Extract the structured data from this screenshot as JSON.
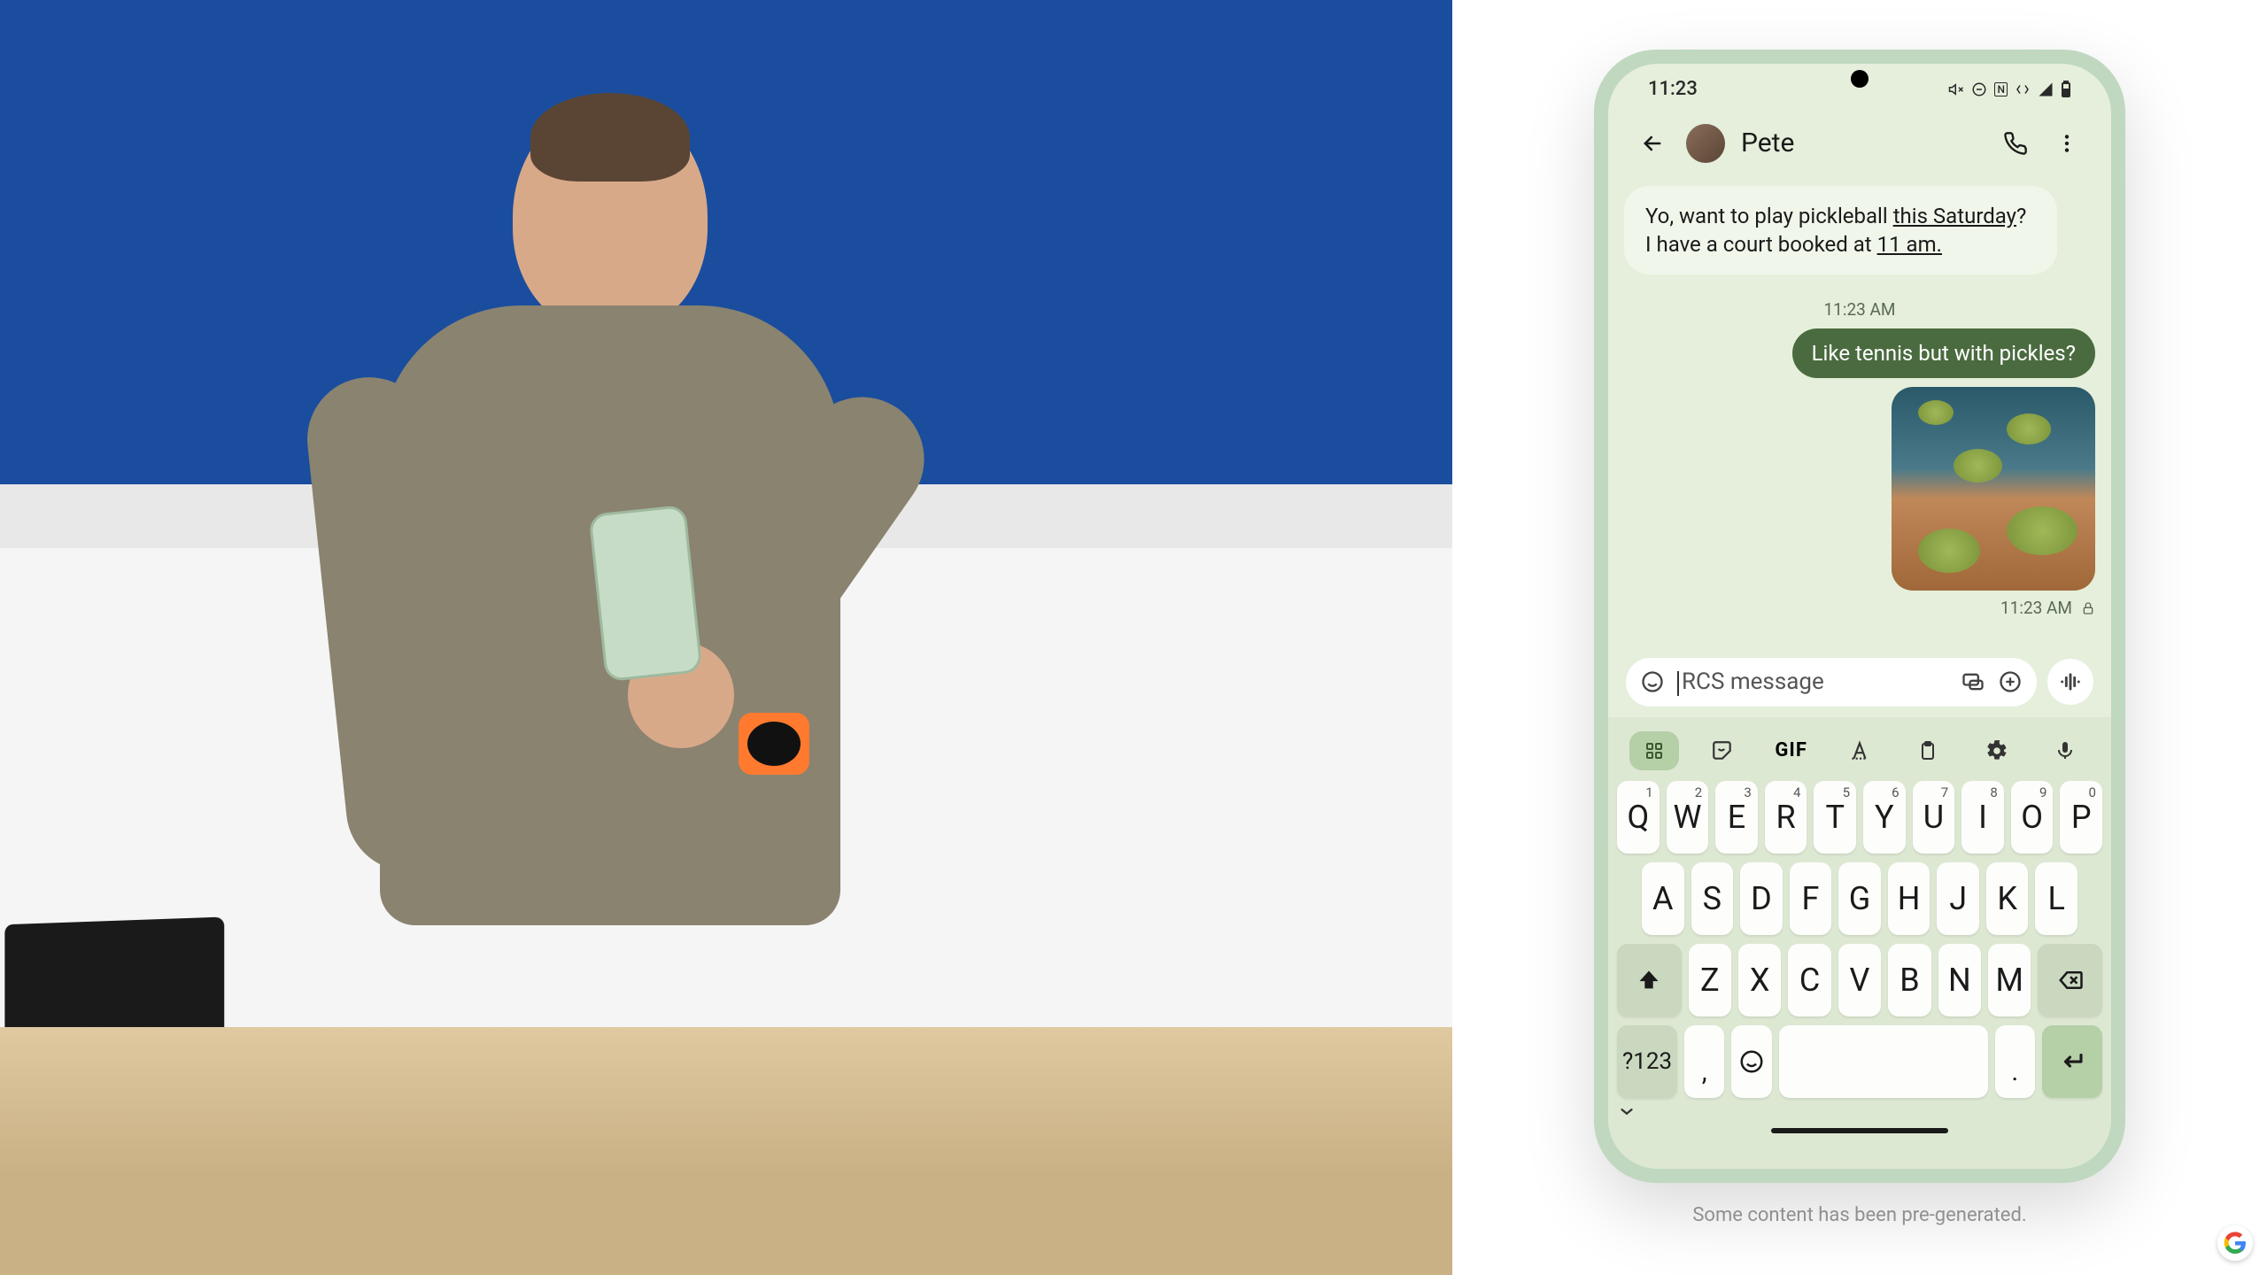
{
  "status_bar": {
    "time": "11:23"
  },
  "chat": {
    "contact_name": "Pete",
    "incoming_msg_prefix": "Yo, want to play pickleball ",
    "incoming_msg_link1": "this Saturday",
    "incoming_msg_mid": "? I have a court booked at ",
    "incoming_msg_link2": "11 am.",
    "center_timestamp": "11:23 AM",
    "outgoing_msg": "Like tennis but with pickles?",
    "out_timestamp": "11:23 AM"
  },
  "compose": {
    "placeholder": "RCS message"
  },
  "keyboard": {
    "symbols_key": "?123",
    "row1": [
      "Q",
      "W",
      "E",
      "R",
      "T",
      "Y",
      "U",
      "I",
      "O",
      "P"
    ],
    "row1_alt": [
      "1",
      "2",
      "3",
      "4",
      "5",
      "6",
      "7",
      "8",
      "9",
      "0"
    ],
    "row2": [
      "A",
      "S",
      "D",
      "F",
      "G",
      "H",
      "J",
      "K",
      "L"
    ],
    "row3": [
      "Z",
      "X",
      "C",
      "V",
      "B",
      "N",
      "M"
    ],
    "gif_label": "GIF",
    "comma": ",",
    "period": "."
  },
  "footnote": "Some content has been pre-generated."
}
